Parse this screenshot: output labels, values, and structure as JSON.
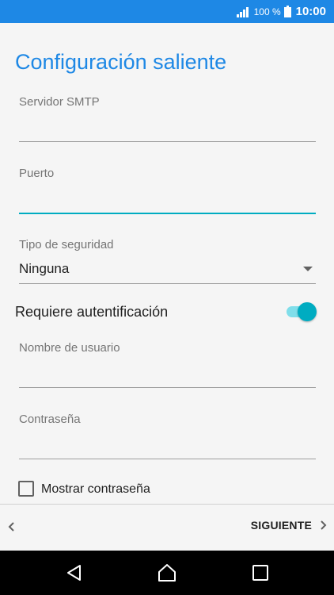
{
  "status_bar": {
    "battery_pct": "100 %",
    "time": "10:00",
    "icons": [
      "signal-icon",
      "battery-icon"
    ]
  },
  "screen": {
    "title": "Configuración saliente"
  },
  "fields": {
    "smtp_server": {
      "label": "Servidor SMTP",
      "value": ""
    },
    "port": {
      "label": "Puerto",
      "value": "",
      "focused": true
    },
    "security": {
      "label": "Tipo de seguridad",
      "value": "Ninguna"
    },
    "requires_auth": {
      "label": "Requiere autentificación",
      "enabled": true
    },
    "username": {
      "label": "Nombre de usuario",
      "value": ""
    },
    "password": {
      "label": "Contraseña",
      "value": ""
    },
    "show_password": {
      "label": "Mostrar contraseña",
      "checked": false
    }
  },
  "footer": {
    "next_label": "SIGUIENTE"
  },
  "colors": {
    "accent": "#1e88e5",
    "toggle": "#00acc1"
  }
}
